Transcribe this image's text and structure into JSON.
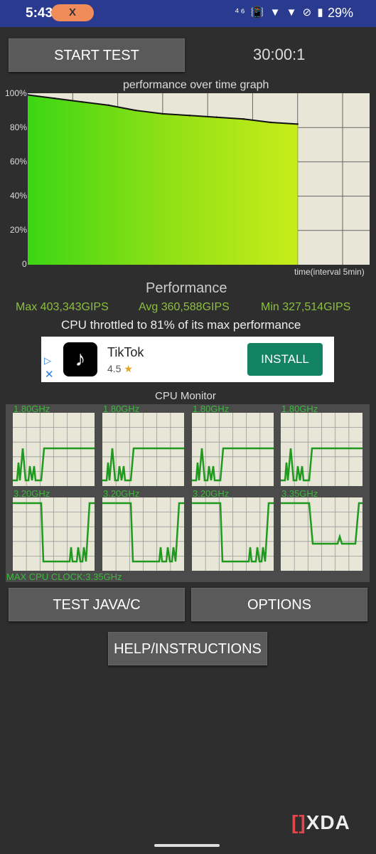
{
  "status_bar": {
    "time": "5:43",
    "pill_label": "X",
    "icons_text": "⁴⁶ 📳 ▼ ▼ ⊘ ▮",
    "battery": "29%"
  },
  "header": {
    "start_label": "START TEST",
    "timer": "30:00:1"
  },
  "graph": {
    "title": "performance over time graph",
    "y_ticks": [
      "100%",
      "80%",
      "60%",
      "40%",
      "20%",
      "0"
    ],
    "x_label": "time(interval 5min)"
  },
  "chart_data": {
    "type": "area",
    "title": "performance over time graph",
    "xlabel": "time(interval 5min)",
    "ylabel": "",
    "ylim": [
      0,
      100
    ],
    "x": [
      0,
      3,
      6,
      9,
      12,
      15,
      18,
      21,
      24,
      27,
      30
    ],
    "series": [
      {
        "values": [
          99,
          97,
          95,
          93,
          90,
          88,
          87,
          86,
          85,
          83,
          82
        ]
      }
    ],
    "grid": true
  },
  "performance": {
    "title": "Performance",
    "max": "Max 403,343GIPS",
    "avg": "Avg 360,588GIPS",
    "min": "Min 327,514GIPS",
    "throttle_text": "CPU throttled to 81% of its max performance"
  },
  "ad": {
    "app_name": "TikTok",
    "rating": "4.5",
    "star": "★",
    "install_label": "INSTALL",
    "logo_glyph": "♪",
    "tri": "▷",
    "close": "✕"
  },
  "cpu_monitor": {
    "title": "CPU Monitor",
    "freqs": [
      "1.80GHz",
      "1.80GHz",
      "1.80GHz",
      "1.80GHz",
      "3.20GHz",
      "3.20GHz",
      "3.20GHz",
      "3.35GHz"
    ],
    "max_clock": "MAX CPU CLOCK:3.35GHz"
  },
  "buttons": {
    "test_java": "TEST JAVA/C",
    "options": "OPTIONS",
    "help": "HELP/INSTRUCTIONS"
  },
  "watermark": {
    "bracket": "[]",
    "text": "XDA"
  },
  "colors": {
    "accent_green": "#3cba3c",
    "status_bar": "#2a3a8f",
    "install": "#128262"
  }
}
